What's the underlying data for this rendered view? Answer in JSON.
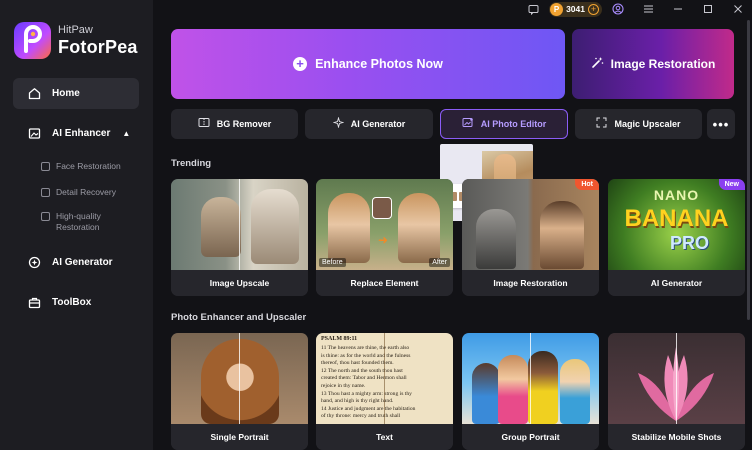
{
  "app": {
    "brand_sub": "HitPaw",
    "brand_main": "FotorPea"
  },
  "topbar": {
    "credits": "3041"
  },
  "sidebar": {
    "home": "Home",
    "ai_enhancer": "AI Enhancer",
    "sub_items": [
      "Face Restoration",
      "Detail Recovery",
      "High-quality Restoration"
    ],
    "ai_generator": "AI Generator",
    "toolbox": "ToolBox"
  },
  "hero": {
    "enhance": "Enhance Photos Now",
    "restoration": "Image Restoration"
  },
  "tools": {
    "bg_remover": "BG Remover",
    "ai_generator": "AI Generator",
    "ai_photo_editor": "AI Photo Editor",
    "magic_upscaler": "Magic Upscaler",
    "more": "•••"
  },
  "trending": {
    "title": "Trending",
    "cards": [
      {
        "label": "Image Upscale"
      },
      {
        "label": "Replace Element",
        "before": "Before",
        "after": "After"
      },
      {
        "label": "Image Restoration",
        "badge": "Hot"
      },
      {
        "label": "AI Generator",
        "badge": "New",
        "art_line1": "NANO",
        "art_line2": "BANANA",
        "art_line3": "PRO"
      }
    ]
  },
  "enhancer": {
    "title": "Photo Enhancer and Upscaler",
    "cards": [
      {
        "label": "Single Portrait"
      },
      {
        "label": "Text",
        "doc_heading": "PSALM 89:11",
        "doc_lines": [
          "11 The heavens are thine, the earth also",
          "is thine: as for the world and the fulness",
          "thereof, thou hast founded them.",
          "12 The north and the south thou hast",
          "created them: Tabor and Hermon shall",
          "rejoice in thy name.",
          "13 Thou hast a mighty arm: strong is thy",
          "hand, and high is thy right hand.",
          "14 Justice and judgment are the habitation",
          "of thy throne: mercy and truth shall"
        ]
      },
      {
        "label": "Group Portrait"
      },
      {
        "label": "Stabilize Mobile Shots"
      }
    ]
  },
  "colors": {
    "accent": "#8b5cf6",
    "hot": "#f0562f",
    "new": "#8b3ff0"
  }
}
